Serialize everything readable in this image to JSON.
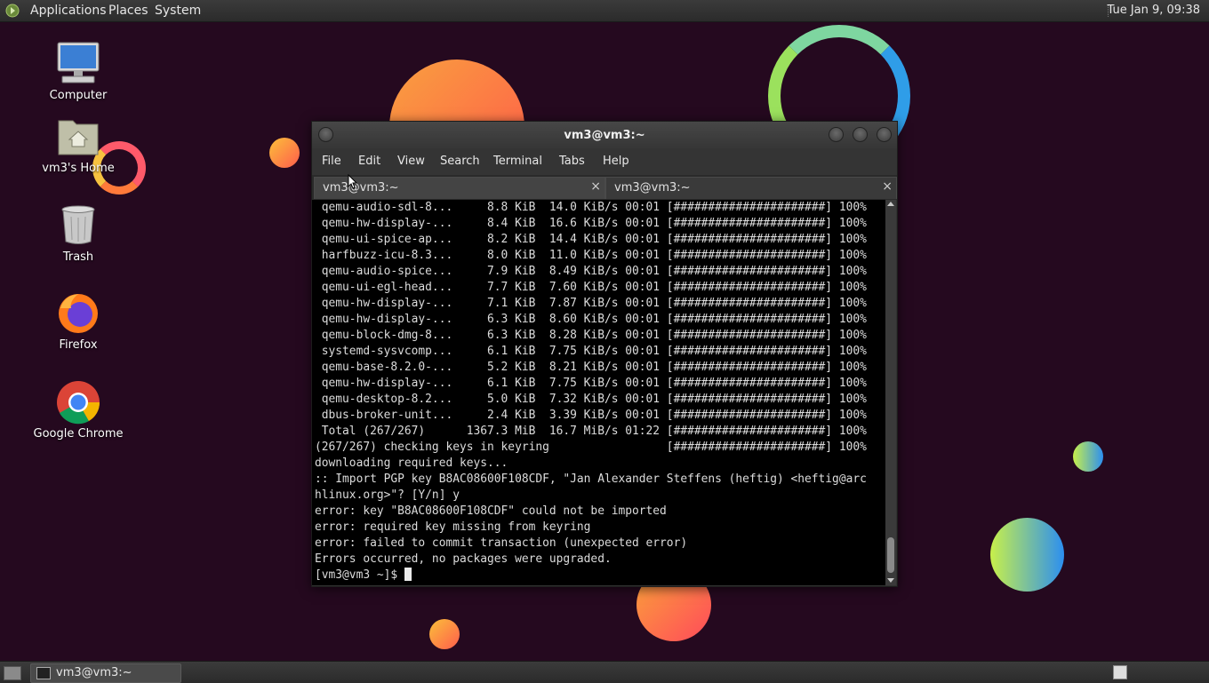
{
  "top_panel": {
    "menus": [
      "Applications",
      "Places",
      "System"
    ],
    "clock": "Tue Jan  9, 09:38"
  },
  "desktop_icons": [
    {
      "label": "Computer",
      "icon": "computer-icon"
    },
    {
      "label": "vm3's Home",
      "icon": "home-folder-icon"
    },
    {
      "label": "Trash",
      "icon": "trash-icon"
    },
    {
      "label": "Firefox",
      "icon": "firefox-icon"
    },
    {
      "label": "Google Chrome",
      "icon": "chrome-icon"
    }
  ],
  "terminal": {
    "title": "vm3@vm3:~",
    "menu": [
      "File",
      "Edit",
      "View",
      "Search",
      "Terminal",
      "Tabs",
      "Help"
    ],
    "tabs": [
      {
        "label": "vm3@vm3:~",
        "close": "×"
      },
      {
        "label": "vm3@vm3:~",
        "close": "×"
      }
    ],
    "lines": [
      " qemu-audio-sdl-8...     8.8 KiB  14.0 KiB/s 00:01 [######################] 100%",
      " qemu-hw-display-...     8.4 KiB  16.6 KiB/s 00:01 [######################] 100%",
      " qemu-ui-spice-ap...     8.2 KiB  14.4 KiB/s 00:01 [######################] 100%",
      " harfbuzz-icu-8.3...     8.0 KiB  11.0 KiB/s 00:01 [######################] 100%",
      " qemu-audio-spice...     7.9 KiB  8.49 KiB/s 00:01 [######################] 100%",
      " qemu-ui-egl-head...     7.7 KiB  7.60 KiB/s 00:01 [######################] 100%",
      " qemu-hw-display-...     7.1 KiB  7.87 KiB/s 00:01 [######################] 100%",
      " qemu-hw-display-...     6.3 KiB  8.60 KiB/s 00:01 [######################] 100%",
      " qemu-block-dmg-8...     6.3 KiB  8.28 KiB/s 00:01 [######################] 100%",
      " systemd-sysvcomp...     6.1 KiB  7.75 KiB/s 00:01 [######################] 100%",
      " qemu-base-8.2.0-...     5.2 KiB  8.21 KiB/s 00:01 [######################] 100%",
      " qemu-hw-display-...     6.1 KiB  7.75 KiB/s 00:01 [######################] 100%",
      " qemu-desktop-8.2...     5.0 KiB  7.32 KiB/s 00:01 [######################] 100%",
      " dbus-broker-unit...     2.4 KiB  3.39 KiB/s 00:01 [######################] 100%",
      " Total (267/267)      1367.3 MiB  16.7 MiB/s 01:22 [######################] 100%",
      "(267/267) checking keys in keyring                 [######################] 100%",
      "downloading required keys...",
      ":: Import PGP key B8AC08600F108CDF, \"Jan Alexander Steffens (heftig) <heftig@arc",
      "hlinux.org>\"? [Y/n] y",
      "error: key \"B8AC08600F108CDF\" could not be imported",
      "error: required key missing from keyring",
      "error: failed to commit transaction (unexpected error)",
      "Errors occurred, no packages were upgraded."
    ],
    "prompt": "[vm3@vm3 ~]$ "
  },
  "bottom_panel": {
    "task_label": "vm3@vm3:~"
  }
}
